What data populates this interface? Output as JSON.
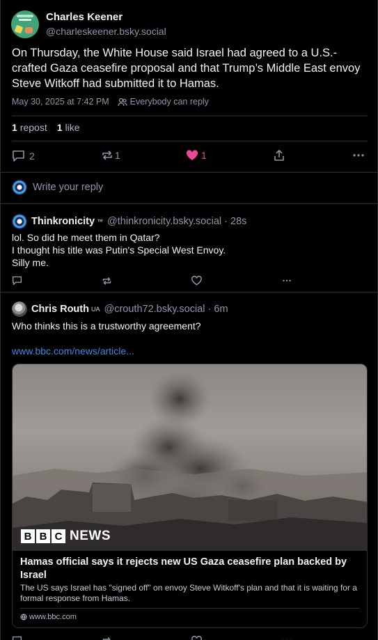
{
  "main_post": {
    "author_name": "Charles Keener",
    "author_handle": "@charleskeener.bsky.social",
    "text": "On Thursday, the White House said Israel had agreed to a U.S.-crafted Gaza ceasefire proposal and that Trump’s Middle East envoy Steve Witkoff had submitted it to Hamas.",
    "timestamp": "May 30, 2025 at 7:42 PM",
    "reply_setting": "Everybody can reply",
    "repost_count": "1",
    "repost_label": "repost",
    "like_count": "1",
    "like_label": "like",
    "actions": {
      "replies": "2",
      "reposts": "1",
      "likes": "1"
    },
    "like_color": "#ec4899"
  },
  "reply_composer": {
    "placeholder": "Write your reply"
  },
  "replies": [
    {
      "author_name": "Thinkronicity",
      "badge": "™",
      "author_handle": "@thinkronicity.bsky.social",
      "time": "28s",
      "text_lines": [
        "lol. So did he meet them in Qatar?",
        "I thought his title was Putin's Special West Envoy.",
        "Silly me."
      ]
    },
    {
      "author_name": "Chris Routh",
      "badge": "UA",
      "author_handle": "@crouth72.bsky.social",
      "time": "6m",
      "text": "Who thinks this is a trustworthy agreement?",
      "link": "www.bbc.com/news/article...",
      "embed": {
        "brand_letters": [
          "B",
          "B",
          "C"
        ],
        "brand_word": "NEWS",
        "title": "Hamas official says it rejects new US Gaza ceasefire plan backed by Israel",
        "description": "The US says Israel has \"signed off\" on envoy Steve Witkoff's plan and that it is waiting for a formal response from Hamas.",
        "domain": "www.bbc.com"
      }
    }
  ],
  "colors": {
    "accent_link": "#3b8be0",
    "muted_text": "#8c98a6",
    "background": "#000000"
  },
  "icons": [
    "reply-icon",
    "repost-icon",
    "heart-icon",
    "share-icon",
    "more-icon",
    "people-icon",
    "globe-icon"
  ]
}
